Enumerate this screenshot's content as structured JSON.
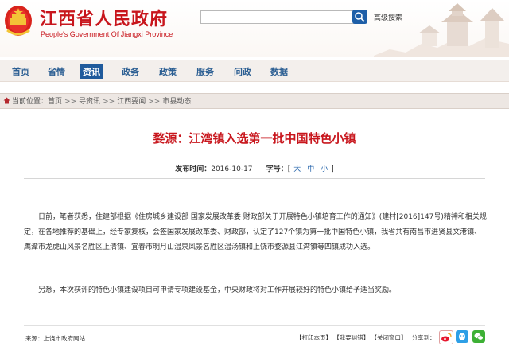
{
  "header": {
    "title": "江西省人民政府",
    "subtitle": "People's Government Of Jiangxi Province",
    "search_placeholder": "",
    "advanced_search": "高级搜索"
  },
  "nav": {
    "items": [
      {
        "label": "首页"
      },
      {
        "label": "省情"
      },
      {
        "label": "资讯",
        "active": true
      },
      {
        "label": "政务"
      },
      {
        "label": "政策"
      },
      {
        "label": "服务"
      },
      {
        "label": "问政"
      },
      {
        "label": "数据"
      }
    ]
  },
  "breadcrumb": {
    "prefix": "当前位置：",
    "items": [
      "首页",
      "寻资讯",
      "江西要闻",
      "市县动态"
    ],
    "separator": ">>"
  },
  "article": {
    "title": "婺源：江湾镇入选第一批中国特色小镇",
    "published_label": "发布时间：",
    "published_date": "2016-10-17",
    "fontsize_label": "字号：",
    "font_sizes": [
      "大",
      "中",
      "小"
    ],
    "paragraphs": [
      "日前，笔者获悉，住建部根据《住房城乡建设部 国家发展改革委 财政部关于开展特色小镇培育工作的通知》(建村[2016]147号)精神和相关规定，在各地推荐的基础上，经专家复核，会签国家发展改革委、财政部，认定了127个镇为第一批中国特色小镇，我省共有南昌市进贤县文港镇、鹰潭市龙虎山风景名胜区上清镇、宜春市明月山温泉风景名胜区温汤镇和上饶市婺源县江湾镇等四镇成功入选。",
      "另悉，本次获评的特色小镇建设项目可申请专项建设基金，中央财政将对工作开展较好的特色小镇给予适当奖励。"
    ]
  },
  "footer": {
    "source": "来源：上饶市政府网站",
    "print": "【打印本页】",
    "correct": "【我要纠错】",
    "close": "【关闭窗口】",
    "share_label": "分享到："
  },
  "colors": {
    "brand_red": "#c8161d",
    "nav_blue": "#1f5a9c"
  }
}
